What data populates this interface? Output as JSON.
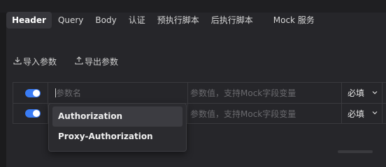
{
  "tabs": [
    {
      "label": "Header",
      "active": true
    },
    {
      "label": "Query"
    },
    {
      "label": "Body"
    },
    {
      "label": "认证"
    },
    {
      "label": "预执行脚本"
    },
    {
      "label": "后执行脚本"
    },
    {
      "label": "Mock 服务"
    }
  ],
  "actions": {
    "import_label": "导入参数",
    "export_label": "导出参数"
  },
  "table": {
    "rows": [
      {
        "enabled": true,
        "name_placeholder": "参数名",
        "value_placeholder": "参数值，支持Mock字段变量",
        "required": "必填"
      },
      {
        "enabled": true,
        "name_placeholder": "",
        "value_placeholder": "参数值，支持Mock字段变量",
        "required": "必填"
      }
    ]
  },
  "autocomplete": {
    "items": [
      "Authorization",
      "Proxy-Authorization"
    ],
    "highlighted_index": 0
  },
  "colors": {
    "accent": "#3a7cf5",
    "background": "#1b1b1d",
    "panel": "#26262a"
  }
}
